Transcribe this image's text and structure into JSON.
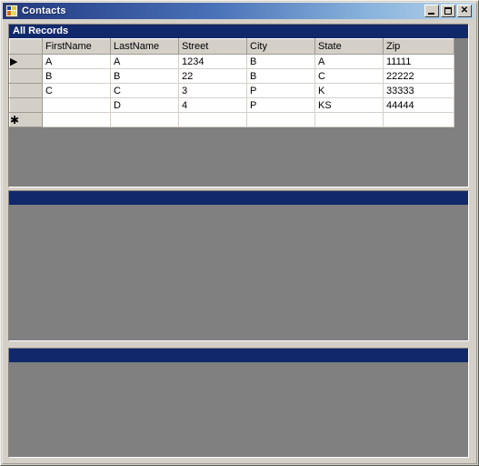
{
  "window": {
    "title": "Contacts",
    "icon": "form-designer-icon",
    "controls": [
      {
        "name": "minimize-button",
        "label": "_"
      },
      {
        "name": "maximize-button",
        "label": "□"
      },
      {
        "name": "close-button",
        "label": "✕"
      }
    ]
  },
  "colors": {
    "title_gradient_start": "#24387a",
    "title_gradient_end": "#b6d2ea",
    "panel_caption": "#11296b",
    "panel_body": "#808080",
    "window_face": "#d4d0c8",
    "grid_cell": "#ffffff",
    "grid_header": "#d4d0c8"
  },
  "panels": [
    {
      "name": "all-records-panel",
      "caption": "All Records"
    },
    {
      "name": "second-panel",
      "caption": ""
    },
    {
      "name": "third-panel",
      "caption": ""
    }
  ],
  "grid": {
    "row_indicator_current": "▶",
    "row_indicator_new": "✱",
    "columns": [
      "FirstName",
      "LastName",
      "Street",
      "City",
      "State",
      "Zip"
    ],
    "rows": [
      {
        "indicator": "current",
        "cells": [
          "A",
          "A",
          "1234",
          "B",
          "A",
          "11111"
        ]
      },
      {
        "indicator": "",
        "cells": [
          "B",
          "B",
          "22",
          "B",
          "C",
          "22222"
        ]
      },
      {
        "indicator": "",
        "cells": [
          "C",
          "C",
          "3",
          "P",
          "K",
          "33333"
        ]
      },
      {
        "indicator": "",
        "cells": [
          "",
          "D",
          "4",
          "P",
          "KS",
          "44444"
        ]
      },
      {
        "indicator": "new",
        "cells": [
          "",
          "",
          "",
          "",
          "",
          ""
        ]
      }
    ]
  }
}
